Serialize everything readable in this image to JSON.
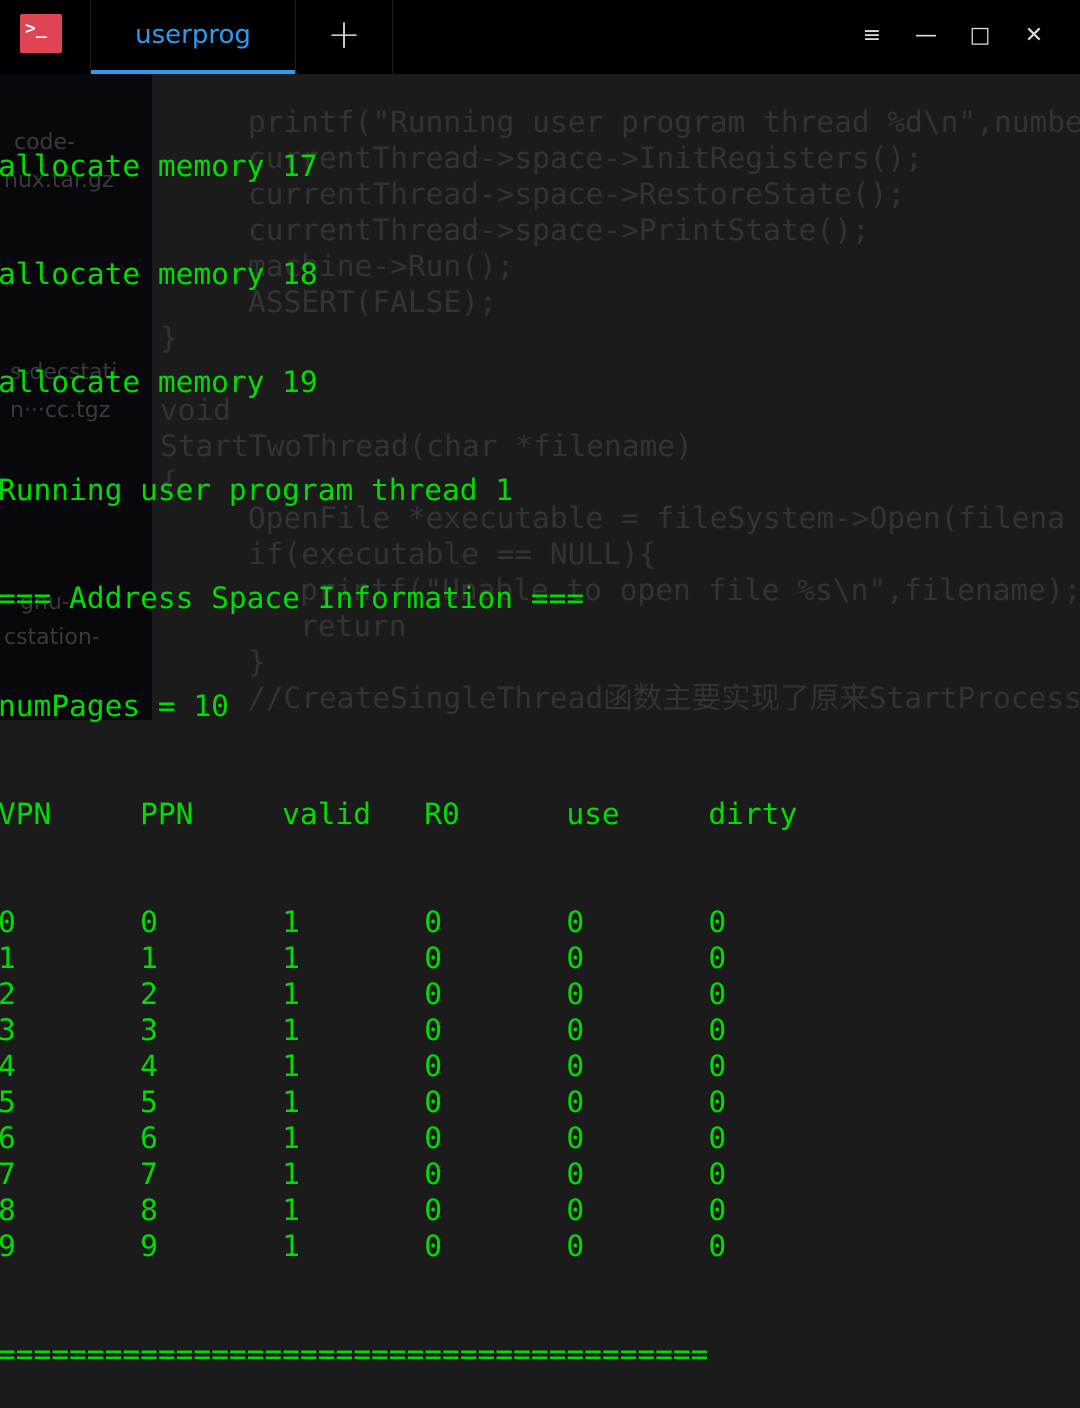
{
  "window": {
    "app_icon": "terminal-icon",
    "tab_label": "userprog",
    "new_tab": "+",
    "controls": {
      "menu": "≡",
      "minimize": "—",
      "maximize": "□",
      "close": "✕"
    },
    "accent": "#2d9cf0",
    "text_color": "#00dd00"
  },
  "terminal": {
    "lines": [
      "allocate memory 17",
      "allocate memory 18",
      "allocate memory 19",
      "Running user program thread 1",
      "=== Address Space Information ===",
      "numPages = 10"
    ],
    "table_header": [
      "VPN",
      "PPN",
      "valid",
      "R0",
      "use",
      "dirty"
    ],
    "table_rows": [
      [
        "0",
        "0",
        "1",
        "0",
        "0",
        "0"
      ],
      [
        "1",
        "1",
        "1",
        "0",
        "0",
        "0"
      ],
      [
        "2",
        "2",
        "1",
        "0",
        "0",
        "0"
      ],
      [
        "3",
        "3",
        "1",
        "0",
        "0",
        "0"
      ],
      [
        "4",
        "4",
        "1",
        "0",
        "0",
        "0"
      ],
      [
        "5",
        "5",
        "1",
        "0",
        "0",
        "0"
      ],
      [
        "6",
        "6",
        "1",
        "0",
        "0",
        "0"
      ],
      [
        "7",
        "7",
        "1",
        "0",
        "0",
        "0"
      ],
      [
        "8",
        "8",
        "1",
        "0",
        "0",
        "0"
      ],
      [
        "9",
        "9",
        "1",
        "0",
        "0",
        "0"
      ]
    ],
    "separator": "========================================"
  },
  "background_desktop": {
    "labels": [
      "code-",
      "nux.tar.gz",
      "s-decstati",
      "n···cc.tgz",
      "gnu-",
      "cstation-"
    ]
  },
  "background_code": [
    "printf(\"Running user program thread %d\\n\",numbe",
    "currentThread->space->InitRegisters();",
    "currentThread->space->RestoreState();",
    "currentThread->space->PrintState();",
    "machine->Run();",
    "ASSERT(FALSE);",
    "}",
    "void",
    "StartTwoThread(char *filename)",
    "{",
    "OpenFile *executable = fileSystem->Open(filena",
    "if(executable == NULL){",
    "printf(\"Unable to open file %s\\n\",filename);",
    "return",
    "}",
    "//CreateSingleThread函数主要实现了原来StartProcess"
  ]
}
